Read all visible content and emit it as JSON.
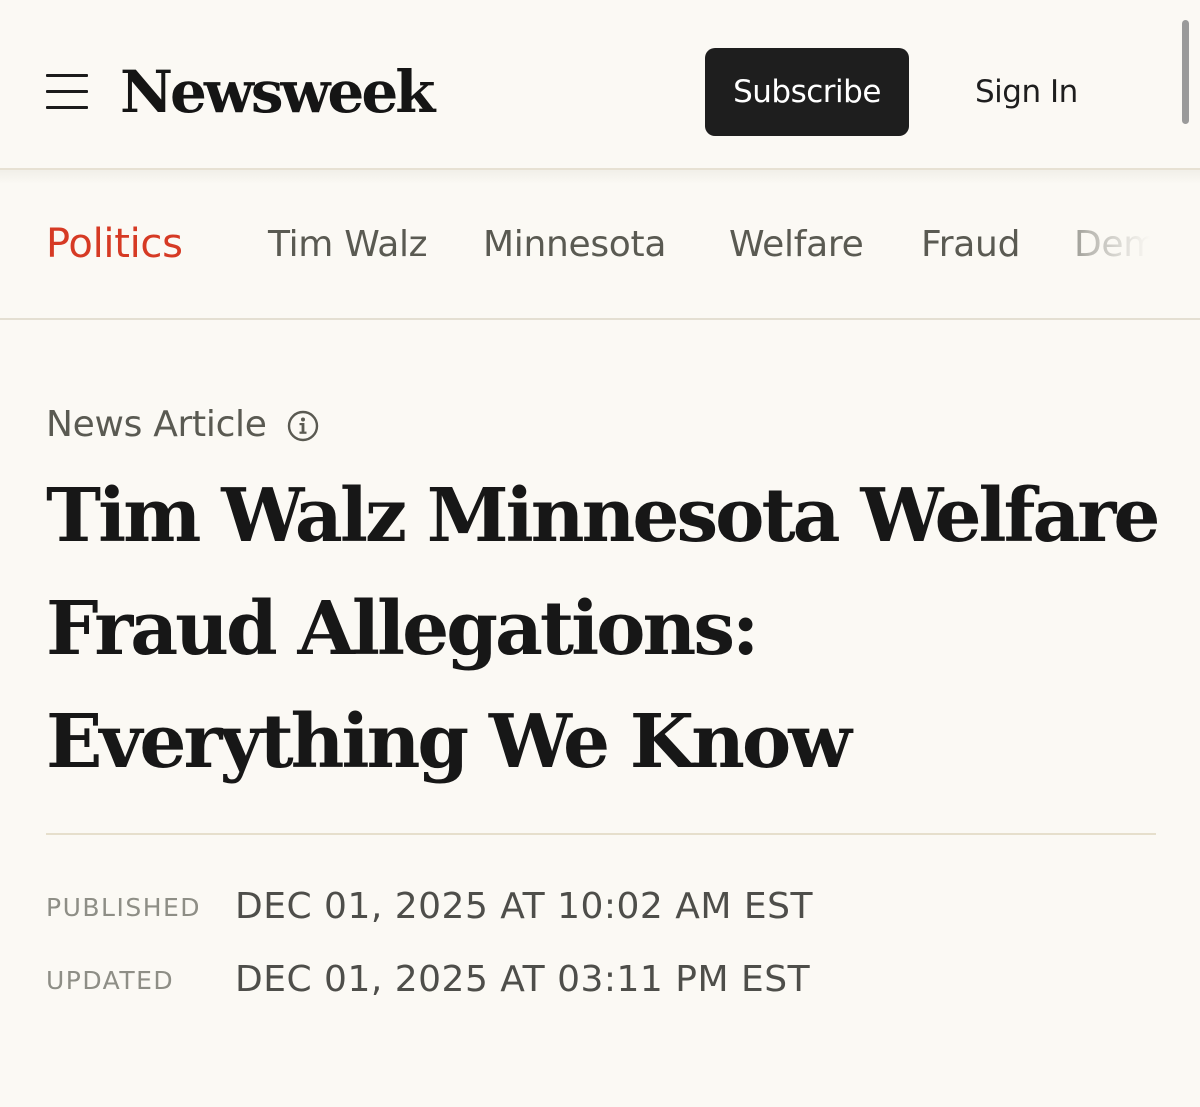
{
  "header": {
    "logo_text": "Newsweek",
    "subscribe_label": "Subscribe",
    "signin_label": "Sign In",
    "menu_icon": "hamburger-menu-icon"
  },
  "topics": {
    "items": [
      {
        "label": "Politics",
        "active": true
      },
      {
        "label": "Tim Walz"
      },
      {
        "label": "Minnesota"
      },
      {
        "label": "Welfare"
      },
      {
        "label": "Fraud"
      },
      {
        "label": "Dem"
      }
    ]
  },
  "article": {
    "type_label": "News Article",
    "info_icon": "info-icon",
    "headline": "Tim Walz Minnesota Welfare Fraud Allegations: Everything We Know",
    "published_label": "PUBLISHED",
    "published_value": "DEC 01, 2025 AT 10:02 AM EST",
    "updated_label": "UPDATED",
    "updated_value": "DEC 01, 2025 AT 03:11 PM EST"
  },
  "colors": {
    "background": "#fbf9f4",
    "accent": "#d63a24",
    "button_bg": "#1e1e1e",
    "text_dark": "#171717",
    "text_muted": "#5a5a52"
  }
}
